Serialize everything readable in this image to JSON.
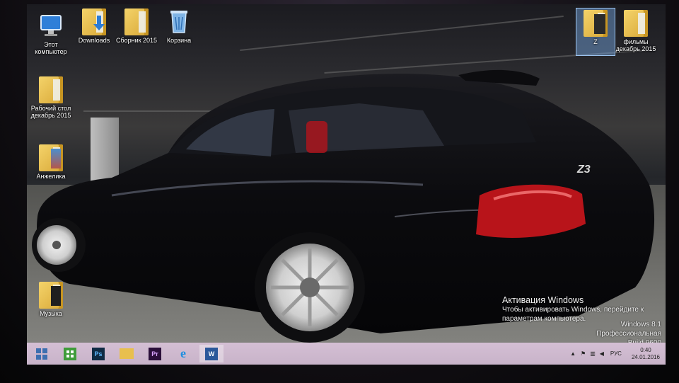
{
  "desktop": {
    "icons": [
      {
        "label": "Этот компьютер",
        "icon": "computer-icon"
      },
      {
        "label": "Downloads",
        "icon": "downloads-folder-icon"
      },
      {
        "label": "Сборник 2015",
        "icon": "folder-icon"
      },
      {
        "label": "Корзина",
        "icon": "recycle-bin-icon"
      },
      {
        "label": "Рабочий стол декабрь 2015",
        "icon": "folder-icon"
      },
      {
        "label": "Анжелика",
        "icon": "folder-icon"
      },
      {
        "label": "Музыка",
        "icon": "folder-icon"
      },
      {
        "label": "Z",
        "icon": "folder-icon"
      },
      {
        "label": "фильмы декабрь 2015",
        "icon": "folder-icon"
      }
    ]
  },
  "wallpaper": {
    "badge": "Z3"
  },
  "taskbar": {
    "apps": [
      {
        "name": "start",
        "glyph": ""
      },
      {
        "name": "store",
        "glyph": ""
      },
      {
        "name": "photoshop",
        "glyph": "Ps"
      },
      {
        "name": "explorer",
        "glyph": ""
      },
      {
        "name": "premiere",
        "glyph": "Pr"
      },
      {
        "name": "internet-explorer",
        "glyph": "e"
      },
      {
        "name": "word",
        "glyph": "W"
      }
    ],
    "language": "РУС",
    "time": "0:40",
    "date": "24.01.2016"
  },
  "activation": {
    "title": "Активация Windows",
    "line1": "Чтобы активировать Windows, перейдите к",
    "line2": "параметрам компьютера.",
    "edition": "Windows 8.1 Профессиональная",
    "build": "Build 9600"
  },
  "colors": {
    "taskbar": "#cbb6cc",
    "folder": "#e8bf4e",
    "selection": "#78aae6"
  }
}
